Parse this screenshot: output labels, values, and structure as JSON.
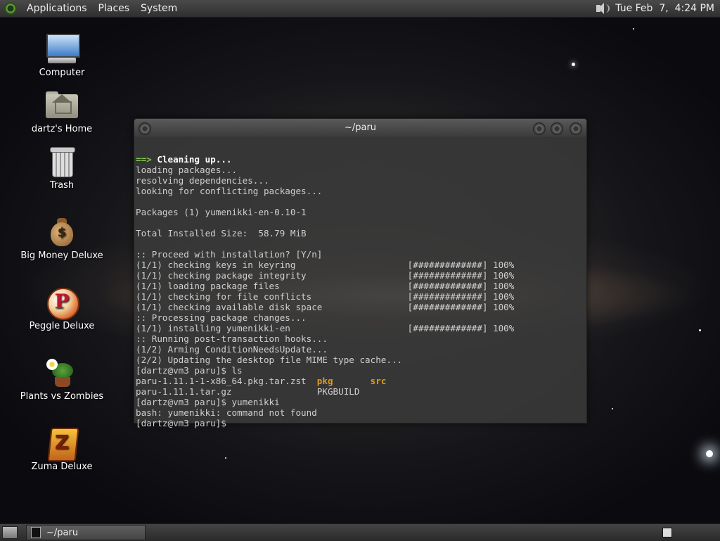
{
  "top_panel": {
    "menus": [
      "Applications",
      "Places",
      "System"
    ],
    "clock": "Tue Feb  7,  4:24 PM"
  },
  "desktop_icons": [
    {
      "label": "Computer",
      "icon": "computer-icon"
    },
    {
      "label": "dartz's Home",
      "icon": "home-folder-icon"
    },
    {
      "label": "Trash",
      "icon": "trash-icon"
    },
    {
      "label": "Big Money Deluxe",
      "icon": "money-bag-icon"
    },
    {
      "label": "Peggle Deluxe",
      "icon": "peggle-icon"
    },
    {
      "label": "Plants vs Zombies",
      "icon": "plants-vs-zombies-icon"
    },
    {
      "label": "Zuma Deluxe",
      "icon": "zuma-icon"
    }
  ],
  "terminal": {
    "title": "~/paru",
    "lines": {
      "l0_arrow": "==>",
      "l0_text": " Cleaning up...",
      "l1": "loading packages...",
      "l2": "resolving dependencies...",
      "l3": "looking for conflicting packages...",
      "l4": "",
      "l5": "Packages (1) yumenikki-en-0.10-1",
      "l6": "",
      "l7": "Total Installed Size:  58.79 MiB",
      "l8": "",
      "l9": ":: Proceed with installation? [Y/n]",
      "l10": "(1/1) checking keys in keyring                     [#############] 100%",
      "l11": "(1/1) checking package integrity                   [#############] 100%",
      "l12": "(1/1) loading package files                        [#############] 100%",
      "l13": "(1/1) checking for file conflicts                  [#############] 100%",
      "l14": "(1/1) checking available disk space                [#############] 100%",
      "l15": ":: Processing package changes...",
      "l16": "(1/1) installing yumenikki-en                      [#############] 100%",
      "l17": ":: Running post-transaction hooks...",
      "l18": "(1/2) Arming ConditionNeedsUpdate...",
      "l19": "(2/2) Updating the desktop file MIME type cache...",
      "l20": "[dartz@vm3 paru]$ ls",
      "l21_a": "paru-1.11.1-1-x86_64.pkg.tar.zst  ",
      "l21_b": "pkg",
      "l21_c": "       ",
      "l21_d": "src",
      "l22": "paru-1.11.1.tar.gz                PKGBUILD",
      "l23": "[dartz@vm3 paru]$ yumenikki",
      "l24": "bash: yumenikki: command not found",
      "l25": "[dartz@vm3 paru]$"
    }
  },
  "taskbar": {
    "task_label": "~/paru"
  }
}
